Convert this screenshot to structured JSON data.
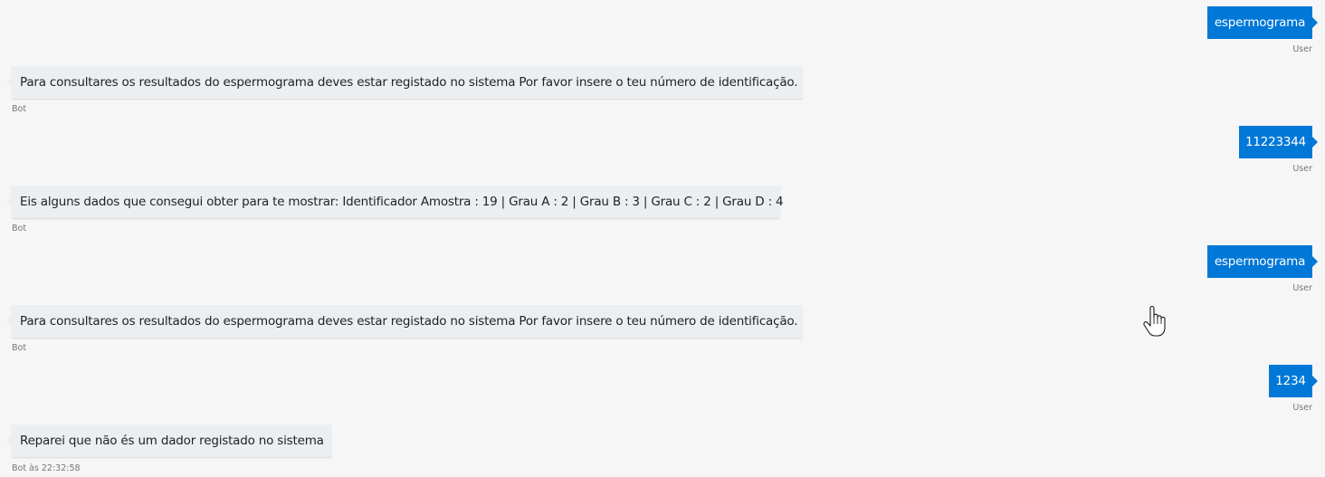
{
  "messages": [
    {
      "from": "user",
      "text": "espermograma",
      "meta": "User"
    },
    {
      "from": "bot",
      "text": "Para consultares os resultados do espermograma deves estar registado no sistema Por favor insere o teu número de identificação.",
      "meta": "Bot"
    },
    {
      "from": "user",
      "text": "11223344",
      "meta": "User"
    },
    {
      "from": "bot",
      "text": "Eis alguns dados que consegui obter para te mostrar: Identificador Amostra : 19 | Grau A : 2 | Grau B : 3 | Grau C : 2 | Grau D : 4",
      "meta": "Bot"
    },
    {
      "from": "user",
      "text": "espermograma",
      "meta": "User"
    },
    {
      "from": "bot",
      "text": "Para consultares os resultados do espermograma deves estar registado no sistema Por favor insere o teu número de identificação.",
      "meta": "Bot"
    },
    {
      "from": "user",
      "text": "1234",
      "meta": "User"
    },
    {
      "from": "bot",
      "text": "Reparei que não és um dador registado no sistema",
      "meta": "Bot às 22:32:58"
    }
  ],
  "colors": {
    "user_bubble": "#0078d7",
    "bot_bubble": "#eceff1",
    "background": "#f6f6f6"
  },
  "icons": {
    "cursor": "hand-pointer-icon"
  }
}
